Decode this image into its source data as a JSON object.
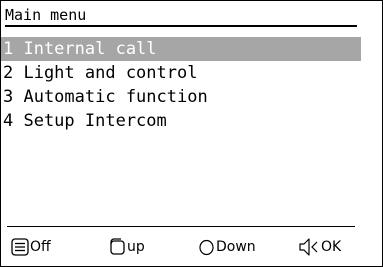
{
  "header": {
    "title": "Main menu"
  },
  "menu": {
    "items": [
      {
        "label": "1 Internal call",
        "selected": true
      },
      {
        "label": "2 Light and control",
        "selected": false
      },
      {
        "label": "3 Automatic function",
        "selected": false
      },
      {
        "label": "4 Setup Intercom",
        "selected": false
      }
    ]
  },
  "softkeys": [
    {
      "icon": "menu-list-icon",
      "label": "Off"
    },
    {
      "icon": "square-key-icon",
      "label": "up"
    },
    {
      "icon": "circle-key-icon",
      "label": "Down"
    },
    {
      "icon": "speaker-icon",
      "label": "OK"
    }
  ],
  "colors": {
    "highlight": "#a6a6a6",
    "highlight_text": "#ffffff",
    "border": "#000000"
  }
}
